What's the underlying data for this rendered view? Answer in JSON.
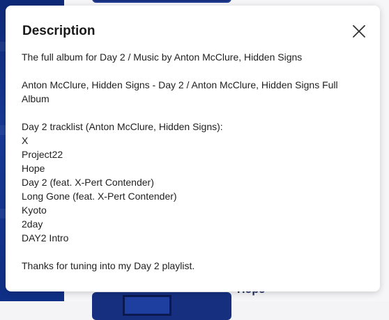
{
  "background": {
    "bottom_item_title": "Hope"
  },
  "dialog": {
    "title": "Description",
    "close_icon": "close-icon",
    "intro": "The full album for Day 2 / Music by Anton McClure, Hidden Signs",
    "album_line": "Anton McClure, Hidden Signs - Day 2 / Anton McClure, Hidden Signs Full Album",
    "tracklist_heading": "Day 2 tracklist (Anton McClure, Hidden Signs):",
    "tracks": [
      "X",
      "Project22",
      "Hope",
      "Day 2 (feat. X-Pert Contender)",
      "Long Gone (feat. X-Pert Contender)",
      "Kyoto",
      "2day",
      "DAY2 Intro"
    ],
    "outro": "Thanks for tuning into my Day 2 playlist."
  }
}
